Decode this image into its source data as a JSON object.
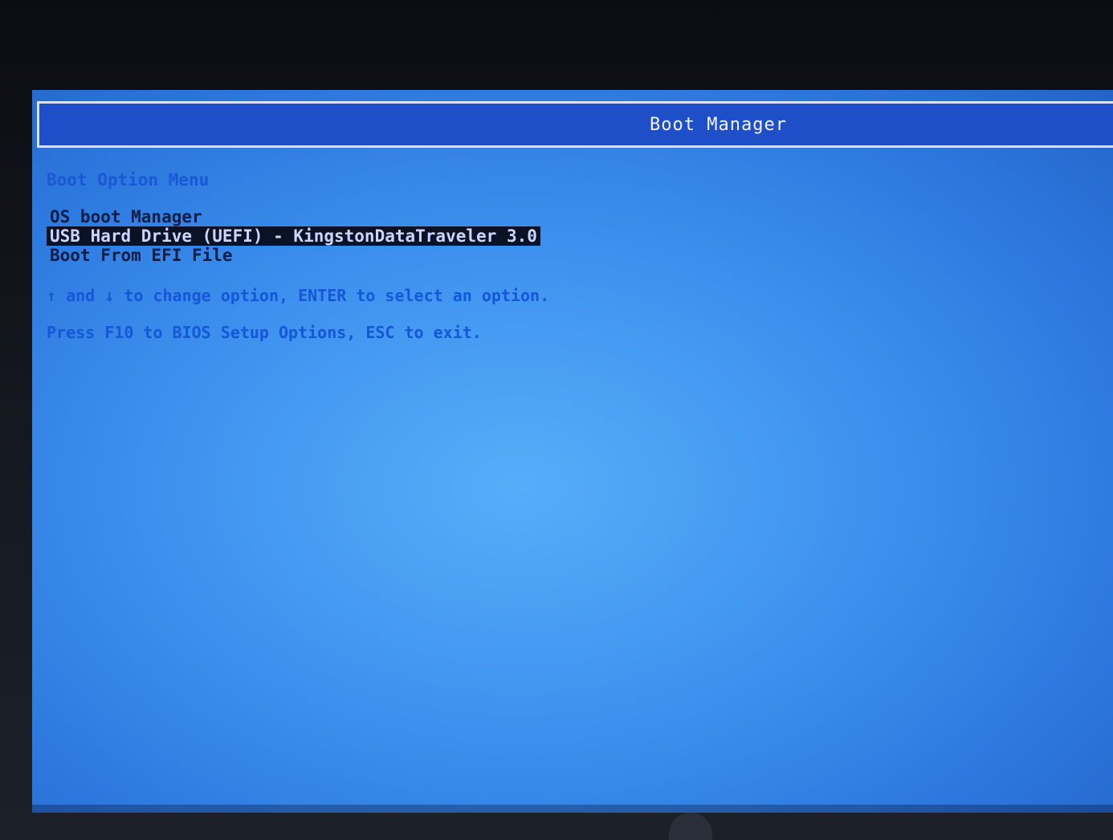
{
  "header": {
    "title": "Boot Manager"
  },
  "menu": {
    "section_title": "Boot Option Menu",
    "options": [
      {
        "label": "OS boot Manager",
        "selected": false
      },
      {
        "label": "USB Hard Drive (UEFI) - KingstonDataTraveler 3.0",
        "selected": true
      },
      {
        "label": "Boot From EFI File",
        "selected": false
      }
    ]
  },
  "hints": {
    "navigation": "↑ and ↓ to change option, ENTER to select an option.",
    "setup": "Press F10 to BIOS Setup Options, ESC to exit."
  },
  "colors": {
    "screen": "#3f93ef",
    "titlebar": "#1f4fc8",
    "selection": "#0a1226",
    "hint_text": "#1656d8"
  }
}
